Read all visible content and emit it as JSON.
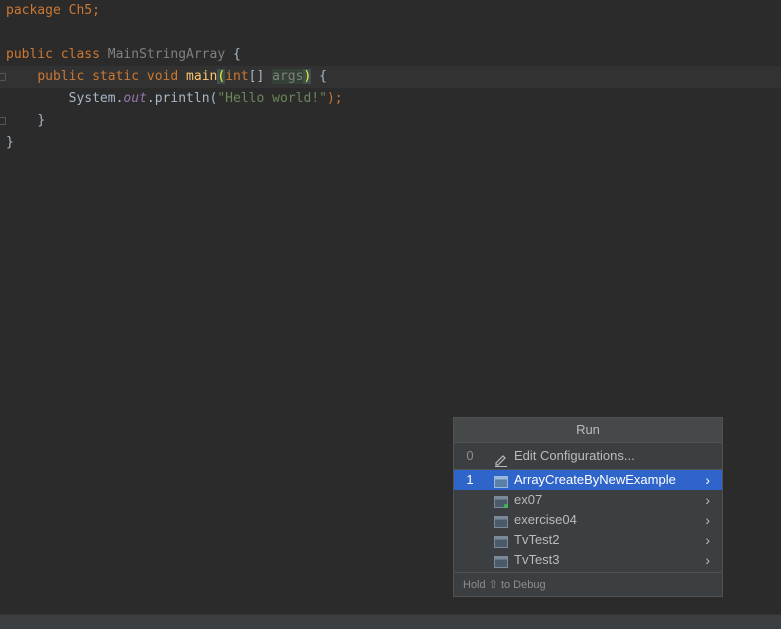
{
  "editor": {
    "line1": {
      "kw": "package",
      "rest": " Ch5;"
    },
    "line3": {
      "kw1": "public",
      "kw2": "class",
      "classname": "MainStringArray",
      "rest": " {"
    },
    "line4": {
      "kw1": "public",
      "kw2": "static",
      "kw3": "void",
      "method": "main",
      "paren_open": "(",
      "type": "int",
      "brackets": "[] ",
      "param": "args",
      "paren_close": ")",
      "rest": " {"
    },
    "line5": {
      "obj": "System.",
      "field": "out",
      "call": ".println(",
      "str": "\"Hello world!\"",
      "end": ");"
    },
    "line6": {
      "text": "}"
    },
    "line7": {
      "text": "}"
    }
  },
  "run_popup": {
    "title": "Run",
    "edit_item": {
      "number": "0",
      "label": "Edit Configurations...",
      "icon": "pencil-icon"
    },
    "items": [
      {
        "number": "1",
        "label": "ArrayCreateByNewExample",
        "icon": "run-config-icon",
        "selected": true
      },
      {
        "number": "",
        "label": "ex07",
        "icon": "run-config-icon"
      },
      {
        "number": "",
        "label": "exercise04",
        "icon": "run-config-icon"
      },
      {
        "number": "",
        "label": "TvTest2",
        "icon": "run-config-icon"
      },
      {
        "number": "",
        "label": "TvTest3",
        "icon": "run-config-icon"
      }
    ],
    "arrow": "›",
    "footer": "Hold ⇧ to Debug"
  },
  "colors": {
    "editor_bg": "#2b2b2b",
    "keyword": "#cc7832",
    "string": "#6a8759",
    "selection": "#2f65ca"
  }
}
